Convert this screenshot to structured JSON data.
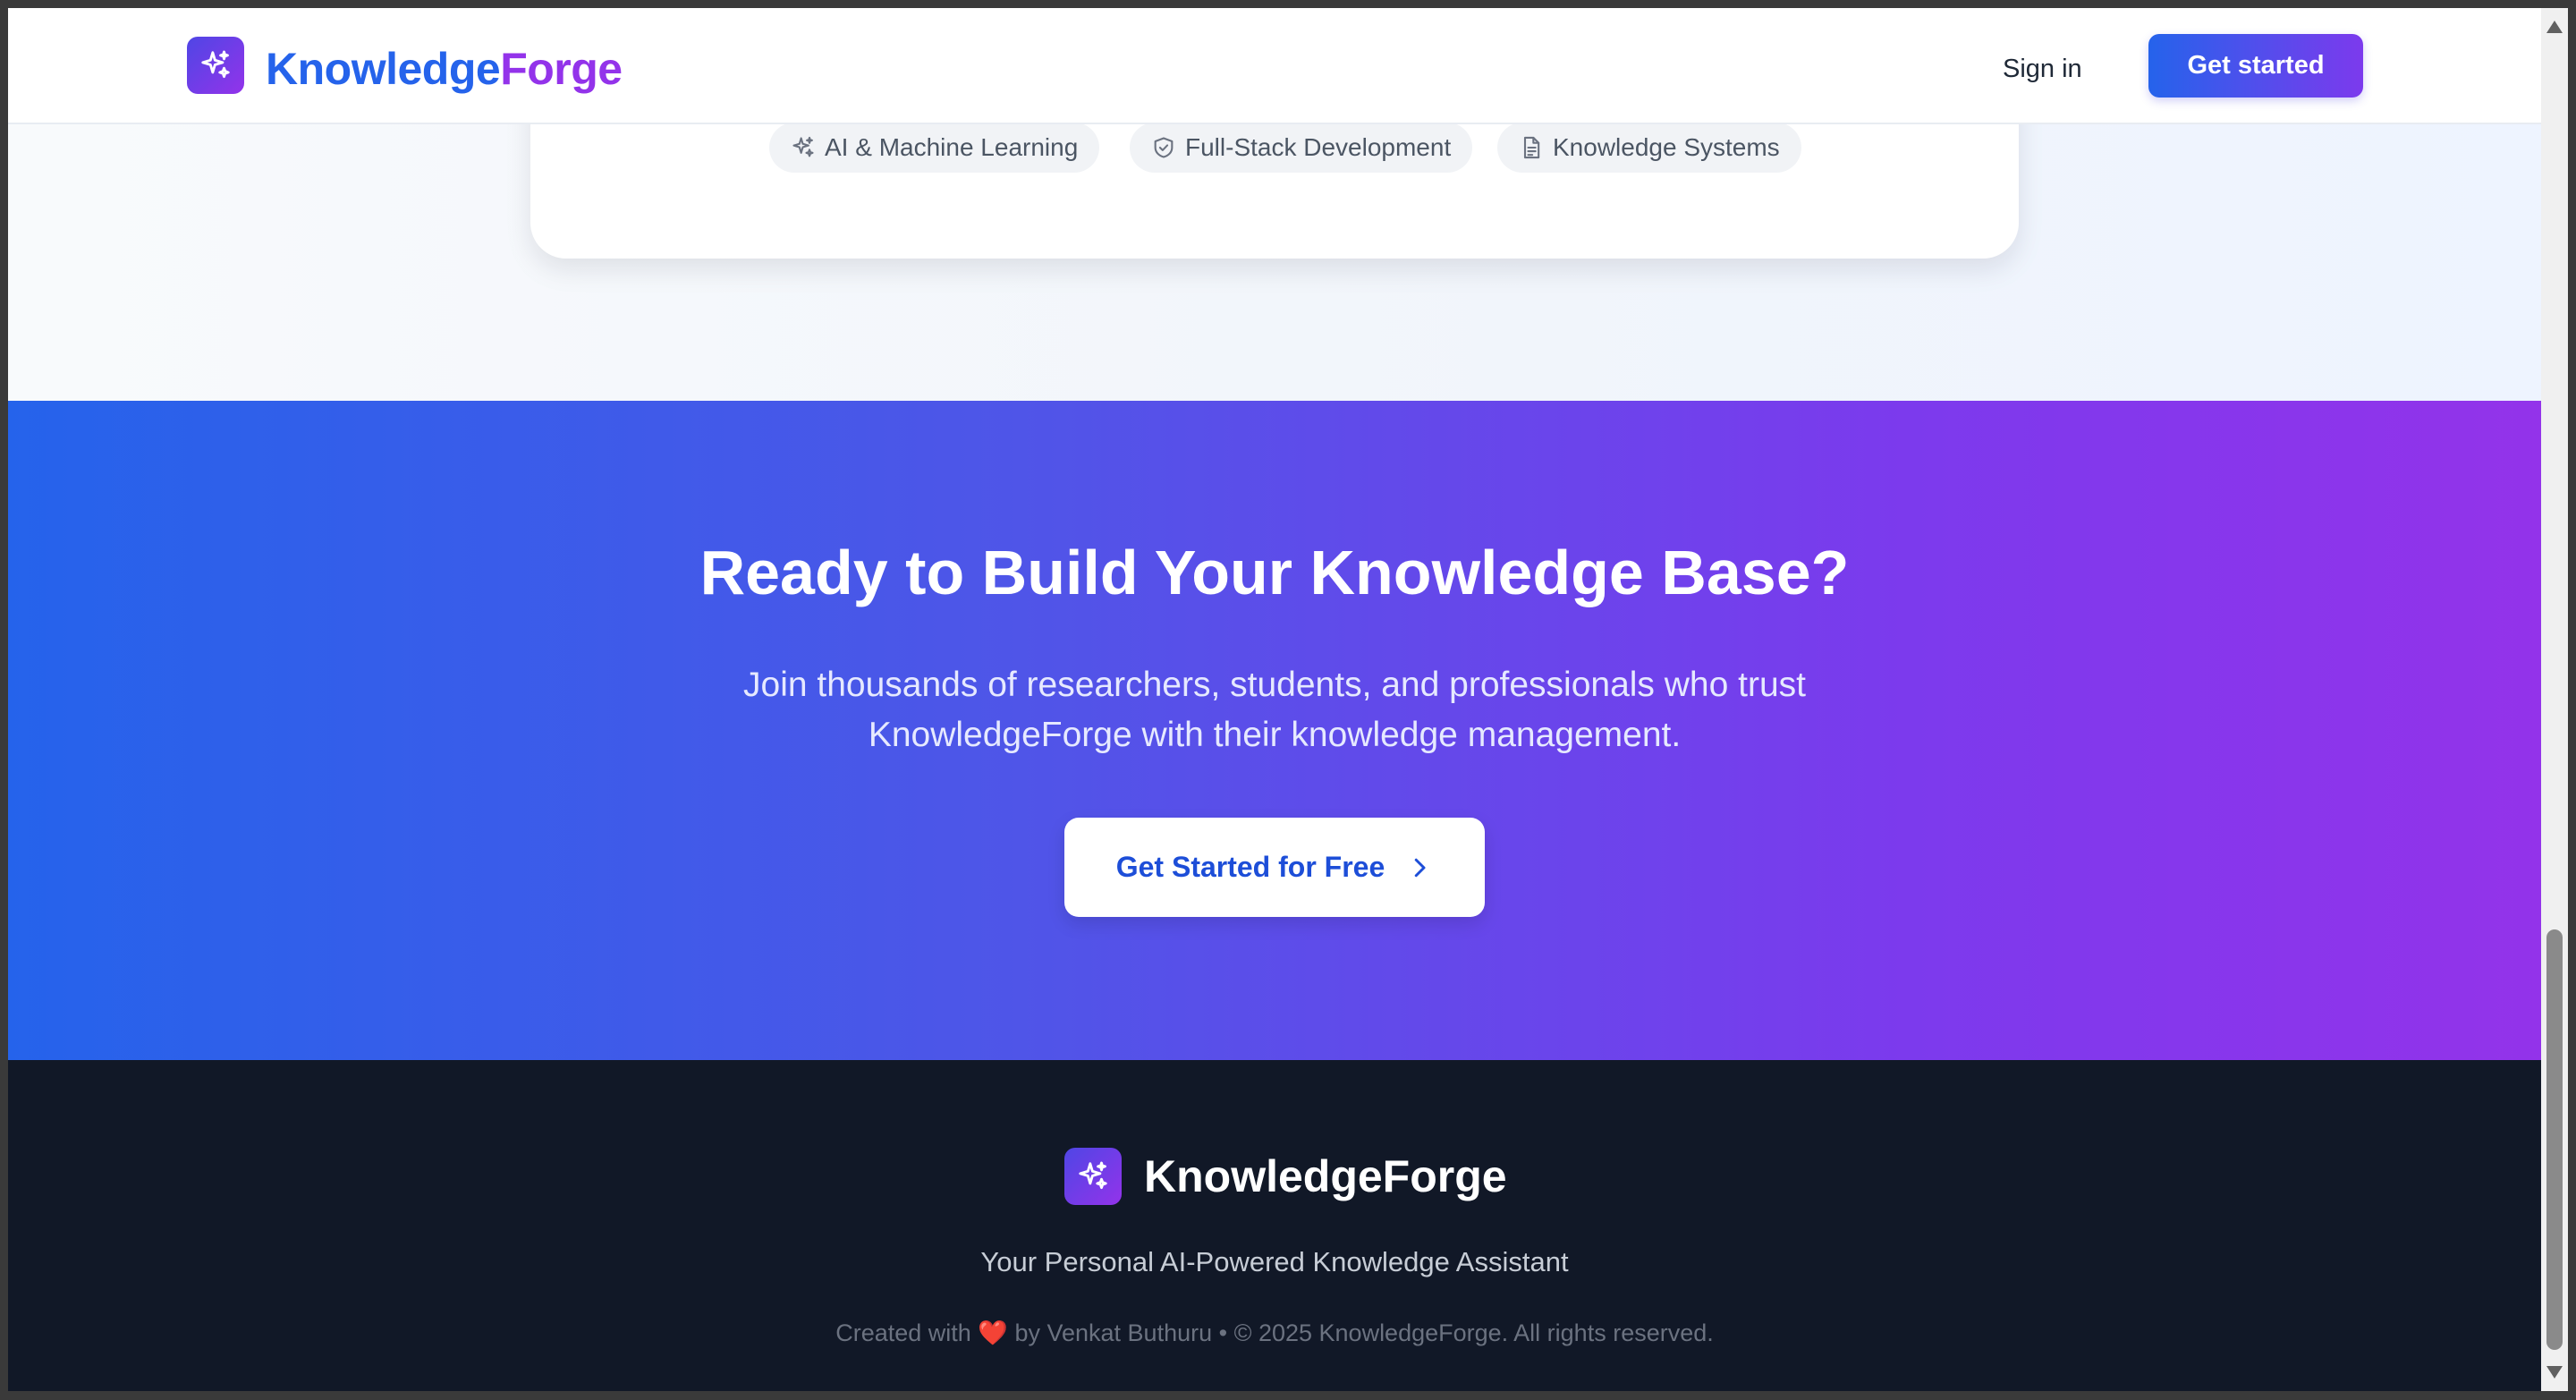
{
  "header": {
    "brand_part1": "Knowledge",
    "brand_part2": "Forge",
    "logo_icon": "sparkles-icon",
    "signin_label": "Sign in",
    "get_started_label": "Get started"
  },
  "features": {
    "chips": [
      {
        "label": "AI & Machine Learning",
        "icon": "sparkles-icon"
      },
      {
        "label": "Full-Stack Development",
        "icon": "shield-check-icon"
      },
      {
        "label": "Knowledge Systems",
        "icon": "document-icon"
      }
    ]
  },
  "cta": {
    "title": "Ready to Build Your Knowledge Base?",
    "subtitle_line1": "Join thousands of researchers, students, and professionals who trust",
    "subtitle_line2": "KnowledgeForge with their knowledge management.",
    "button_label": "Get Started for Free",
    "button_icon": "chevron-right-icon"
  },
  "footer": {
    "brand": "KnowledgeForge",
    "tagline": "Your Personal AI-Powered Knowledge Assistant",
    "credit_prefix": "Created with",
    "credit_heart": "❤️",
    "credit_suffix": "by Venkat Buthuru • © 2025 KnowledgeForge. All rights reserved."
  },
  "colors": {
    "brand_blue": "#2563eb",
    "brand_purple": "#9333ea",
    "footer_bg": "#111827"
  }
}
